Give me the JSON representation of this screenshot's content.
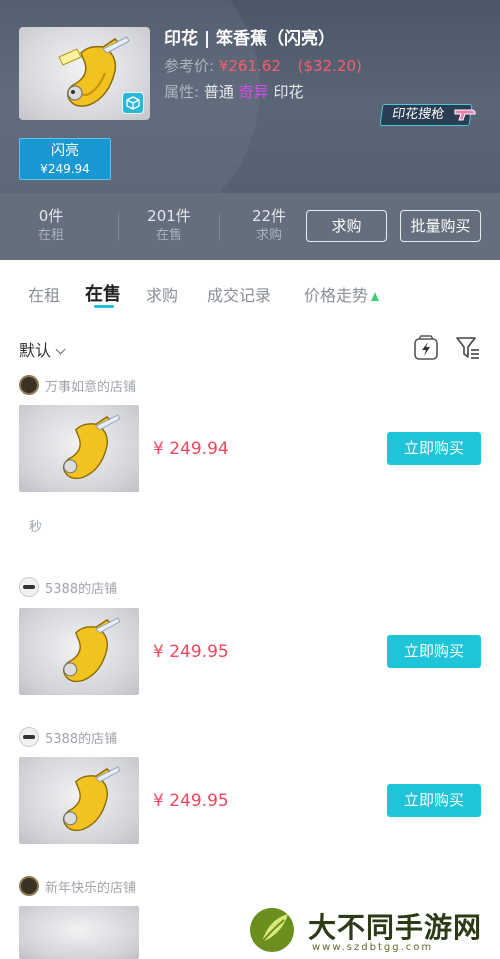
{
  "item": {
    "title": "印花 | 笨香蕉（闪亮）",
    "ref_label": "参考价:",
    "ref_price_cny": "¥261.62",
    "ref_price_usd": "($32.20)",
    "attr_label": "属性:",
    "attr_quality": "普通",
    "attr_rarity": "奇异",
    "attr_type": "印花",
    "search_gun_label": "印花搜枪",
    "variant_name": "闪亮",
    "variant_price": "¥249.94"
  },
  "stats": {
    "rent_count": "0件",
    "rent_label": "在租",
    "sale_count": "201件",
    "sale_label": "在售",
    "want_count": "22件",
    "want_label": "求购",
    "want_button": "求购",
    "bulk_button": "批量购买"
  },
  "tabs": {
    "rent": "在租",
    "sale": "在售",
    "want": "求购",
    "records": "成交记录",
    "trend": "价格走势"
  },
  "sort": {
    "label": "默认"
  },
  "listings": [
    {
      "store": "万事如意的店铺",
      "price": "¥ 249.94",
      "buy": "立即购买"
    },
    {
      "store": "5388的店铺",
      "price": "¥ 249.95",
      "buy": "立即购买"
    },
    {
      "store": "5388的店铺",
      "price": "¥ 249.95",
      "buy": "立即购买"
    },
    {
      "store": "新年快乐的店铺"
    }
  ],
  "listing_note": "秒",
  "watermark": {
    "name": "大不同手游网",
    "url": "www.szdbtgg.com"
  },
  "colors": {
    "accent": "#1ec4d8",
    "price": "#f0475e",
    "rarity": "#d94bf0",
    "variant": "#1a98d1"
  }
}
